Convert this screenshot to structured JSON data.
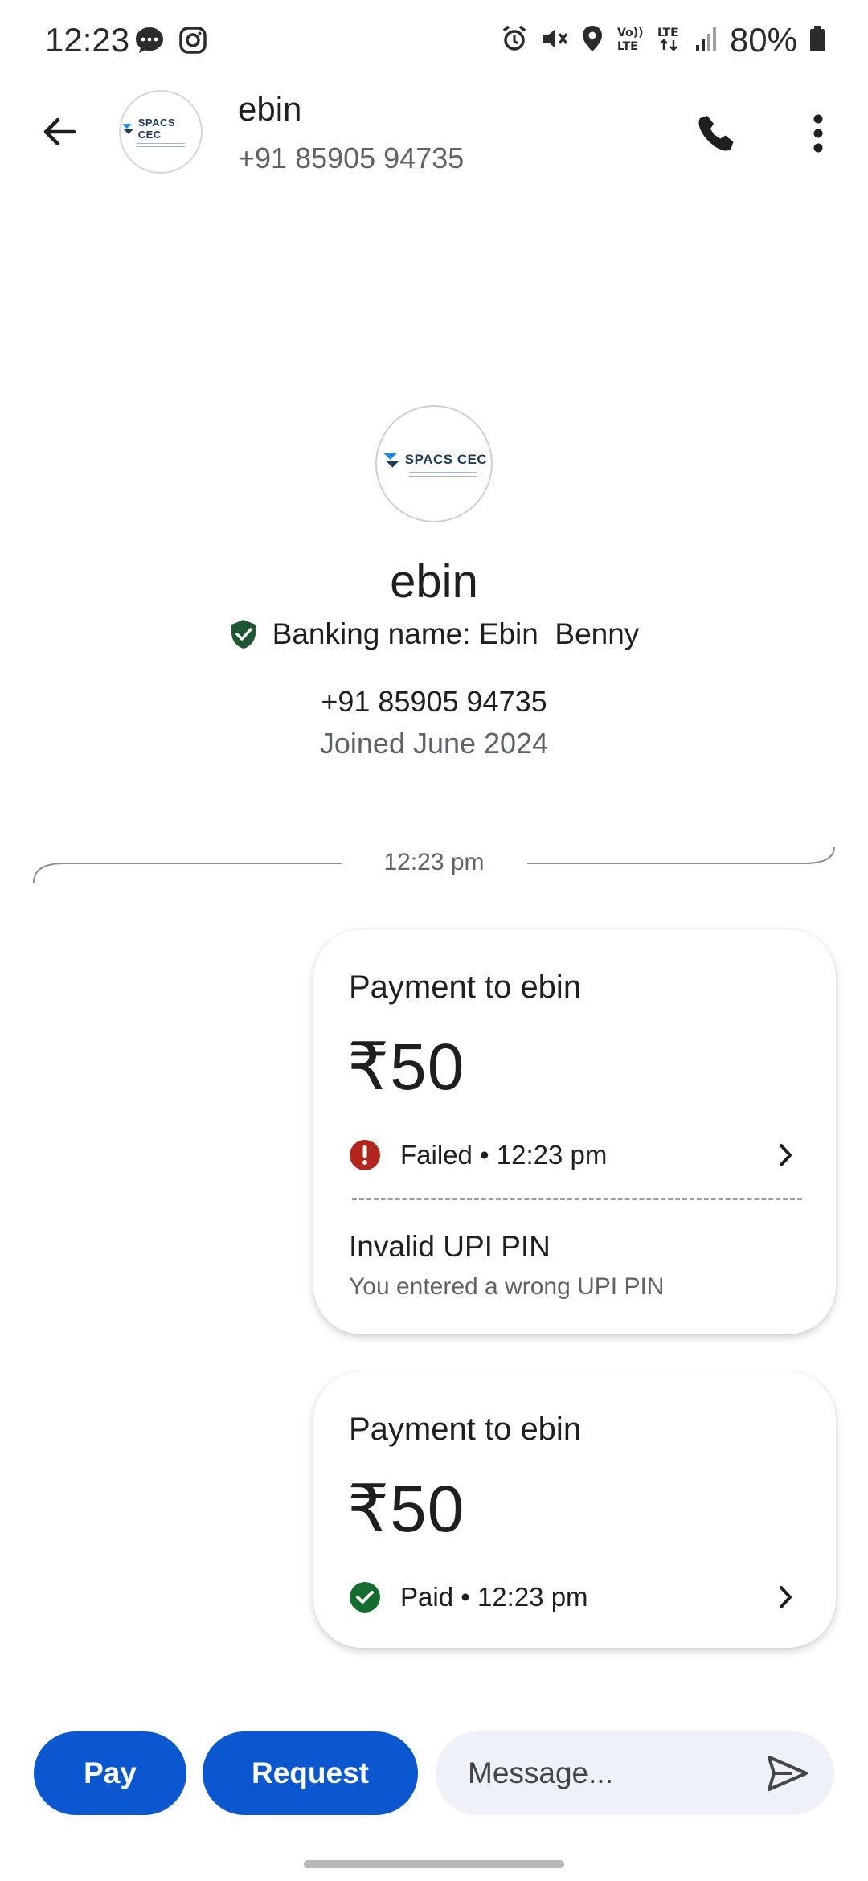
{
  "status_bar": {
    "time": "12:23",
    "battery": "80%",
    "left_icons": [
      "chat-bubble-icon",
      "instagram-icon"
    ],
    "right_icons": [
      "alarm-icon",
      "mute-icon",
      "location-icon",
      "volte-icon",
      "lte-icon",
      "signal-icon",
      "battery-icon"
    ],
    "volte_label": "Vo))\nLTE",
    "lte_label": "LTE"
  },
  "header": {
    "name": "ebin",
    "phone": "+91 85905 94735",
    "avatar_logo": "SPACS CEC"
  },
  "profile": {
    "avatar_logo": "SPACS CEC",
    "name": "ebin",
    "banking_name": "Banking name: Ebin  Benny",
    "phone": "+91 85905 94735",
    "joined": "Joined June 2024"
  },
  "timeline": {
    "divider_time": "12:23 pm"
  },
  "payments": [
    {
      "title": "Payment to ebin",
      "amount": "₹50",
      "status": "Failed • 12:23 pm",
      "status_type": "failed",
      "error_title": "Invalid UPI PIN",
      "error_detail": "You entered a wrong UPI PIN"
    },
    {
      "title": "Payment to ebin",
      "amount": "₹50",
      "status": "Paid • 12:23 pm",
      "status_type": "paid"
    }
  ],
  "composer": {
    "pay_label": "Pay",
    "request_label": "Request",
    "message_placeholder": "Message..."
  },
  "colors": {
    "accent": "#0b57d0",
    "failed": "#b3261e",
    "paid": "#146c2e",
    "verified_shield": "#1e5631"
  }
}
